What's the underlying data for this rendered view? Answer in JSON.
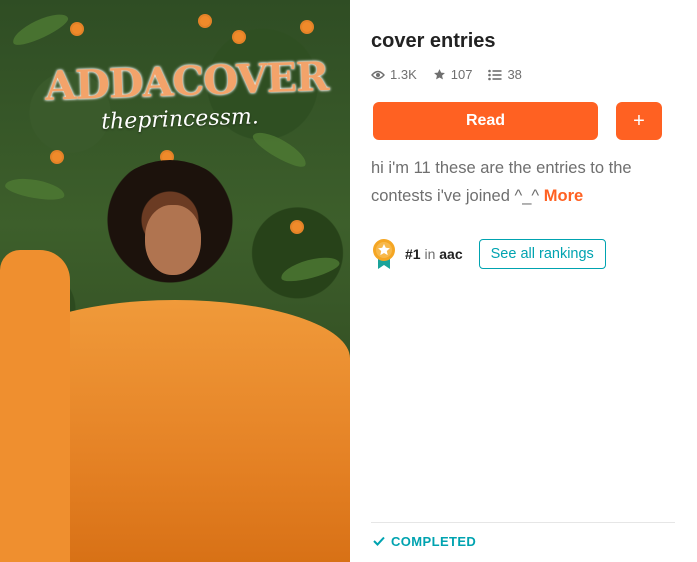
{
  "cover": {
    "logo_title": "ADDACOVER",
    "logo_subtitle": "theprincessm."
  },
  "story": {
    "title": "cover entries",
    "stats": {
      "reads": "1.3K",
      "votes": "107",
      "parts": "38"
    },
    "actions": {
      "read_label": "Read",
      "add_label": "+"
    },
    "description": "hi i'm 11 these are the entries to the contests i've joined ^_^",
    "more_label": "More",
    "ranking": {
      "position": "#1",
      "connector": "in",
      "tag": "aac",
      "see_all_label": "See all rankings"
    },
    "status": "COMPLETED"
  },
  "colors": {
    "accent": "#ff6122",
    "teal": "#00a3b0",
    "muted_text": "#6f6f6f"
  },
  "icons": [
    "eye-icon",
    "star-icon",
    "list-icon",
    "ranking-badge-icon",
    "check-icon"
  ]
}
